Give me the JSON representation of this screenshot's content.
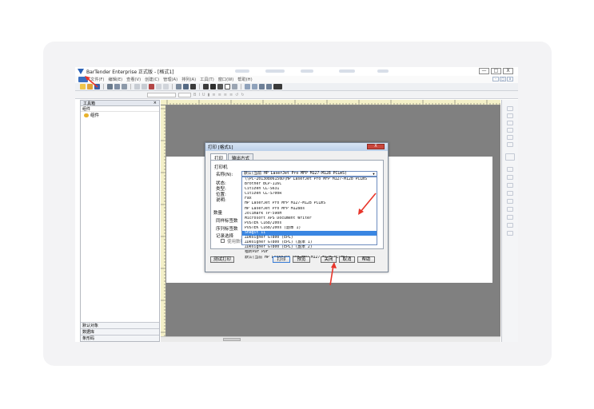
{
  "app": {
    "title": "BarTender Enterprise 正式版 - [格式1]",
    "window_buttons": [
      "—",
      "□",
      "X"
    ],
    "mdi_buttons": [
      "-",
      "□",
      "x"
    ]
  },
  "menu": {
    "items": [
      "文件(F)",
      "编辑(E)",
      "查看(V)",
      "创建(C)",
      "管理(A)",
      "排列(A)",
      "工具(T)",
      "窗口(W)",
      "帮助(H)"
    ]
  },
  "toolbox": {
    "title": "工具箱",
    "close": "×",
    "tab": "组件",
    "tree_item": "组件",
    "bottom_tabs": [
      "默认对象",
      "数据库",
      "条形码"
    ]
  },
  "dialog": {
    "title": "打印 [格式1]",
    "close": "X",
    "tabs": [
      "打印",
      "输出方式"
    ],
    "section": "打印机",
    "name_label": "名称(N):",
    "selected_printer": "默认(当前 HP LaserJet Pro MFP M127-M128 PCLmS)",
    "labels": {
      "status": "状态:",
      "type": "类型:",
      "location": "位置:",
      "comment": "说明:",
      "quantity": "数量",
      "copies": "同样标签数",
      "serial": "序列标签数",
      "records": "记录选择",
      "use_db": "使用数据库"
    },
    "printers": [
      "\\\\PC-20130806150D\\HP LaserJet Pro MFP M127-M128 PCLmS",
      "Brother BCP-116C",
      "Citizen CL-S631",
      "Citizen CL-S700R",
      "Fax",
      "HP LaserJet Pro MFP M127-M128 PCLmS",
      "HP LaserJet Pro MFP M1288s",
      "Jolimark TP-590H",
      "Microsoft XPS Document Writer",
      "POSTEK C168/200s",
      "POSTEK C168/200s (副本 1)",
      "Snagit 11",
      "ZDesigner GT800 (EPL)",
      "ZDesigner GT800 (EPL) (副本 1)",
      "ZDesigner GT800 (EPL) (副本 2)",
      "福昕PDF PDF",
      "默认(当前 HP LaserJet Pro MFP M127-M128 PCLmS)"
    ],
    "selected_index": 11,
    "buttons": {
      "test": "测试打印",
      "print": "打印",
      "preview": "预览",
      "close": "关闭",
      "cancel": "取消",
      "help": "帮助"
    }
  },
  "colors": {
    "accent": "#3a86e2",
    "arrow": "#e8352a",
    "canvas": "#808080"
  },
  "icons": [
    "app-logo-icon",
    "new-icon",
    "open-icon",
    "save-icon",
    "print-icon",
    "cut-icon",
    "copy-icon",
    "paste-icon",
    "undo-icon",
    "redo-icon",
    "text-icon",
    "line-icon",
    "rectangle-icon",
    "zoom-in-icon",
    "zoom-out-icon"
  ]
}
